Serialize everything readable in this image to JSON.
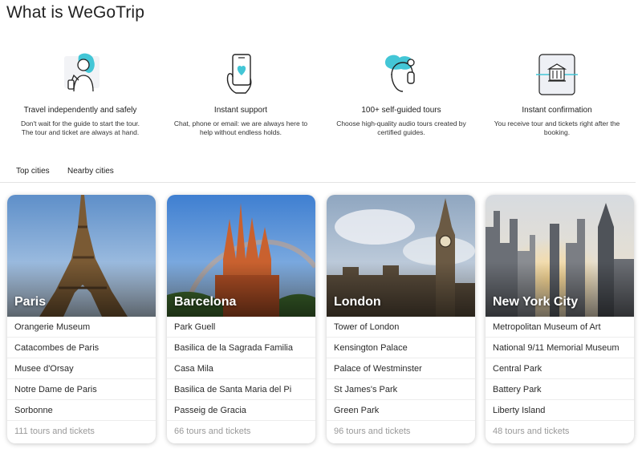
{
  "page": {
    "title": "What is WeGoTrip"
  },
  "colors": {
    "accent": "#43c6d6",
    "count_text": "#999999"
  },
  "features": [
    {
      "icon": "traveler-icon",
      "title": "Travel independently and safely",
      "desc_lines": [
        "Don't wait for the guide to start the tour.",
        "The tour and ticket are always at hand."
      ]
    },
    {
      "icon": "phone-support-icon",
      "title": "Instant support",
      "desc_lines": [
        "Chat, phone or email: we are always here to",
        "help without endless holds."
      ]
    },
    {
      "icon": "headphones-icon",
      "title": "100+ self-guided tours",
      "desc_lines": [
        "Choose high-quality audio tours created by",
        "certified guides."
      ]
    },
    {
      "icon": "ticket-icon",
      "title": "Instant confirmation",
      "desc_lines": [
        "You receive tour and tickets right after the",
        "booking."
      ]
    }
  ],
  "tabs": [
    "Top cities",
    "Nearby cities"
  ],
  "cities": [
    {
      "name": "Paris",
      "attractions": [
        "Orangerie Museum",
        "Catacombes de Paris",
        "Musee d'Orsay",
        "Notre Dame de Paris",
        "Sorbonne"
      ],
      "count": "111 tours and tickets"
    },
    {
      "name": "Barcelona",
      "attractions": [
        "Park Guell",
        "Basilica de la Sagrada Familia",
        "Casa Mila",
        "Basilica de Santa Maria del Pi",
        "Passeig de Gracia"
      ],
      "count": "66 tours and tickets"
    },
    {
      "name": "London",
      "attractions": [
        "Tower of London",
        "Kensington Palace",
        "Palace of Westminster",
        "St James's Park",
        "Green Park"
      ],
      "count": "96 tours and tickets"
    },
    {
      "name": "New York City",
      "attractions": [
        "Metropolitan Museum of Art",
        "National 9/11 Memorial Museum",
        "Central Park",
        "Battery Park",
        "Liberty Island"
      ],
      "count": "48 tours and tickets"
    }
  ]
}
